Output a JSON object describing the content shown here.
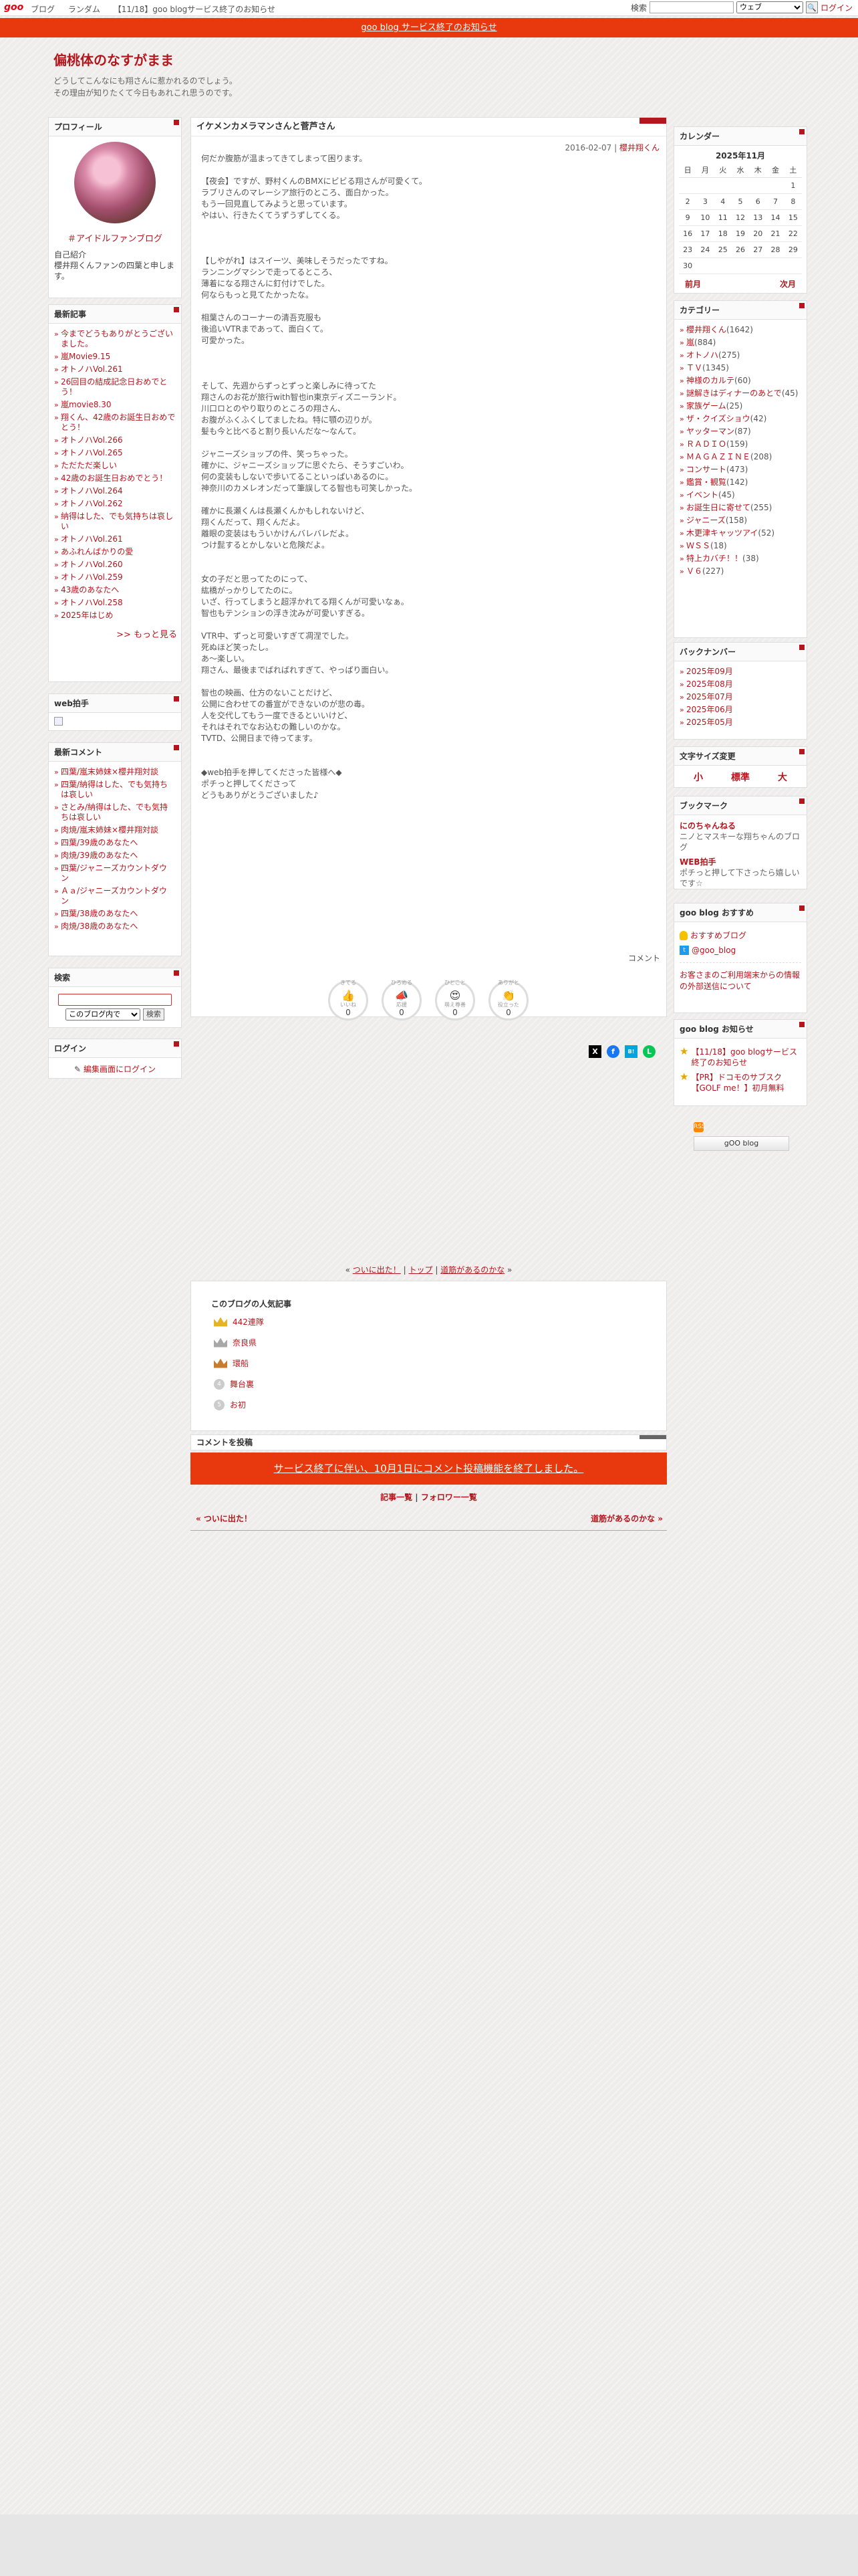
{
  "topbar": {
    "logo": "goo",
    "nav": [
      "ブログ",
      "ランダム",
      "【11/18】goo blogサービス終了のお知らせ"
    ],
    "search_label": "検索",
    "search_scope": "ウェブ",
    "login": "ログイン"
  },
  "notice_bar": "goo blog サービス終了のお知らせ",
  "blog": {
    "title": "偏桃体のなすがまま",
    "description": "どうしてこんなにも翔さんに惹かれるのでしょう。\nその理由が知りたくて今日もあれこれ思うのです。"
  },
  "profile": {
    "heading": "プロフィール",
    "fan_link": "＃アイドルファンブログ",
    "bio_label": "自己紹介",
    "bio": "櫻井翔くんファンの四葉と申します。"
  },
  "recent": {
    "heading": "最新記事",
    "items": [
      "今までどうもありがとうございました。",
      "嵐Movie9.15",
      "オトノハVol.261",
      "26回目の結成記念日おめでとう！",
      "嵐movie8.30",
      "翔くん、42歳のお誕生日おめでとう！",
      "オトノハVol.266",
      "オトノハVol.265",
      "ただただ楽しい",
      "42歳のお誕生日おめでとう！",
      "オトノハVol.264",
      "オトノハVol.262",
      "納得はした、でも気持ちは哀しい",
      "オトノハVol.261",
      "あふれんばかりの愛",
      "オトノハVol.260",
      "オトノハVol.259",
      "43歳のあなたへ",
      "オトノハVol.258",
      "2025年はじめ"
    ],
    "more": ">> もっと見る"
  },
  "webclap": {
    "heading": "web拍手"
  },
  "comments": {
    "heading": "最新コメント",
    "items": [
      "四葉/嵐末姉妹×櫻井翔対談",
      "四葉/納得はした、でも気持ちは哀しい",
      "さとみ/納得はした、でも気持ちは哀しい",
      "肉焼/嵐末姉妹×櫻井翔対談",
      "四葉/39歳のあなたへ",
      "肉焼/39歳のあなたへ",
      "四葉/ジャニーズカウントダウン",
      "Ａａ/ジャニーズカウントダウン",
      "四葉/38歳のあなたへ",
      "肉焼/38歳のあなたへ"
    ]
  },
  "search_box": {
    "heading": "検索",
    "scope": "このブログ内で",
    "button": "検索"
  },
  "login_box": {
    "heading": "ログイン",
    "link": "編集画面にログイン"
  },
  "article": {
    "title": "イケメンカメラマンさんと菅芦さん",
    "date": "2016-02-07",
    "category": "櫻井翔くん",
    "body": "何だか腹筋が温まってきてしまって困ります。\n\n【夜会】ですが、野村くんのBMXにビビる翔さんが可愛くて。\nラブリさんのマレーシア旅行のところ、面白かった。\nもう一回見直してみようと思っています。\nやはい、行きたくてうずうずしてくる。\n\n\n\n【しやがれ】はスイーツ、美味しそうだったですね。\nランニングマシンで走ってるところ、\n薄着になる翔さんに釘付けでした。\n何ならもっと見てたかったな。\n\n相葉さんのコーナーの清吾克服も\n後追いVTRまであって、面白くて。\n可愛かった。\n\n\n\nそして、先週からずっとずっと楽しみに待ってた\n翔さんのお花が旅行with智也in東京ディズニーランド。\n川口ロとのやり取りのところの翔さん、\nお腹がふくふくしてましたね。特に顎の辺りが。\n髪も今と比べると割り長いんだな～なんて。\n\nジャニーズショップの件、笑っちゃった。\n確かに、ジャニーズショップに思ぐたら、そうすごいわ。\n何の変装もしないで歩いてることいっぱいあるのに。\n神奈川のカメレオンだって筆誤してる智也も可笑しかった。\n\n確かに長瀬くんは長瀬くんかもしれないけど、\n翔くんだって、翔くんだよ。\n離眼の変装はもういかけんバレバレだよ。\nつけ髭するとかしないと危険だよ。\n\n\n女の子だと思ってたのにって、\n紘橋がっかりしてたのに。\nいざ、行ってしまうと超浮かれてる翔くんが可愛いなぁ。\n智也もテンションの浮き沈みが可愛いすぎる。\n\nVTR中、ずっと可愛いすぎて凋涅でした。\n死ぬほど笑ったし。\nあ～楽しい。\n翔さん、最後までばればれすぎて、やっぱり面白い。\n\n智也の映画、仕方のないことだけど、\n公開に合わせての番宣ができないのが悲の毒。\n人を交代してもう一度できるといいけど、\nそれはそれでなお込むの難しいのかな。\nTVTD、公開日まで待ってます。\n\n\n◆web拍手を押してくださった皆様へ◆\nポチっと押してくださって\nどうもありがとうございました♪",
    "comment_link": "コメント",
    "reactions": [
      {
        "top": "きてる",
        "icon": "👍",
        "label": "いいね",
        "count": "0"
      },
      {
        "top": "ひろめる",
        "icon": "📣",
        "label": "応援",
        "count": "0"
      },
      {
        "top": "ひとこと",
        "icon": "😍",
        "label": "萌え尊善",
        "count": "0"
      },
      {
        "top": "ありがと",
        "icon": "👏",
        "label": "役立った",
        "count": "0"
      }
    ],
    "share": [
      "X",
      "f",
      "B!",
      "L"
    ]
  },
  "calendar": {
    "heading": "カレンダー",
    "month": "2025年11月",
    "weekdays": [
      "日",
      "月",
      "火",
      "水",
      "木",
      "金",
      "土"
    ],
    "weeks": [
      [
        "",
        "",
        "",
        "",
        "",
        "",
        "1"
      ],
      [
        "2",
        "3",
        "4",
        "5",
        "6",
        "7",
        "8"
      ],
      [
        "9",
        "10",
        "11",
        "12",
        "13",
        "14",
        "15"
      ],
      [
        "16",
        "17",
        "18",
        "19",
        "20",
        "21",
        "22"
      ],
      [
        "23",
        "24",
        "25",
        "26",
        "27",
        "28",
        "29"
      ],
      [
        "30",
        "",
        "",
        "",
        "",
        "",
        ""
      ]
    ],
    "prev": "前月",
    "next": "次月"
  },
  "category": {
    "heading": "カテゴリー",
    "items": [
      {
        "name": "櫻井翔くん",
        "count": "(1642)"
      },
      {
        "name": "嵐",
        "count": "(884)"
      },
      {
        "name": "オトノハ",
        "count": "(275)"
      },
      {
        "name": "ＴＶ",
        "count": "(1345)"
      },
      {
        "name": "神様のカルテ",
        "count": "(60)"
      },
      {
        "name": "謎解きはディナーのあとで",
        "count": "(45)"
      },
      {
        "name": "家族ゲーム",
        "count": "(25)"
      },
      {
        "name": "ザ・クイズショウ",
        "count": "(42)"
      },
      {
        "name": "ヤッターマン",
        "count": "(87)"
      },
      {
        "name": "ＲＡＤＩＯ",
        "count": "(159)"
      },
      {
        "name": "ＭＡＧＡＺＩＮＥ",
        "count": "(208)"
      },
      {
        "name": "コンサート",
        "count": "(473)"
      },
      {
        "name": "鑑賞・観覧",
        "count": "(142)"
      },
      {
        "name": "イベント",
        "count": "(45)"
      },
      {
        "name": "お誕生日に寄せて",
        "count": "(255)"
      },
      {
        "name": "ジャニーズ",
        "count": "(158)"
      },
      {
        "name": "木更津キャッツアイ",
        "count": "(52)"
      },
      {
        "name": "ＷＳＳ",
        "count": "(18)"
      },
      {
        "name": "特上カバチ！！",
        "count": "(38)"
      },
      {
        "name": "Ｖ６",
        "count": "(227)"
      }
    ]
  },
  "backnumber": {
    "heading": "バックナンバー",
    "items": [
      "2025年09月",
      "2025年08月",
      "2025年07月",
      "2025年06月",
      "2025年05月"
    ]
  },
  "fontsize": {
    "heading": "文字サイズ変更",
    "options": [
      "小",
      "標準",
      "大"
    ]
  },
  "bookmark": {
    "heading": "ブックマーク",
    "items": [
      {
        "name": "にのちゃんねる",
        "desc": "ニノとマスキーな翔ちゃんのブログ"
      },
      {
        "name": "WEB拍手",
        "desc": "ポチっと押して下さったら嬉しいです☆"
      }
    ]
  },
  "recommend": {
    "heading": "goo blog おすすめ",
    "blog_link": "おすすめブログ",
    "twitter": "@goo_blog",
    "notice": "お客さまのご利用端末からの情報の外部送信について"
  },
  "notices": {
    "heading": "goo blog お知らせ",
    "items": [
      "【11/18】goo blogサービス終了のお知らせ",
      "【PR】ドコモのサブスク【GOLF me！】初月無料"
    ]
  },
  "rss_label": "RSS",
  "goo_badge": "gOO blog",
  "pager1": {
    "prev": "ついに出た！",
    "top": "トップ",
    "next": "道筋があるのかな",
    "left_mark": "«",
    "right_mark": "»",
    "sep": "|"
  },
  "popular": {
    "title": "このブログの人気記事",
    "items": [
      "442連隊",
      "奈良県",
      "環船",
      "舞台裏",
      "お初"
    ],
    "ranks": [
      "4",
      "5"
    ]
  },
  "comment_post": {
    "heading": "コメントを投稿",
    "closed": "サービス終了に伴い、10月1日にコメント投稿機能を終了しました。"
  },
  "pager2": {
    "list": "記事一覧",
    "sep": "|",
    "followers": "フォロワー一覧"
  },
  "pager3": {
    "prev": "« ついに出た！",
    "next": "道筋があるのかな »"
  }
}
